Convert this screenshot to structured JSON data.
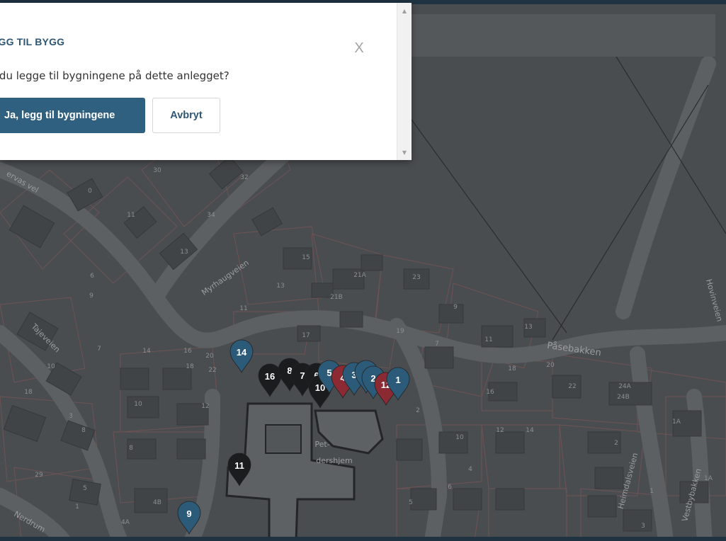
{
  "dialog": {
    "title": "EGG TIL BYGG",
    "close_label": "X",
    "message": "l du legge til bygningene på dette anlegget?",
    "confirm_label": "Ja, legg til bygningene",
    "cancel_label": "Avbryt"
  },
  "map": {
    "street_labels": [
      "Myrhaugveien",
      "Påsebakken",
      "Hovinveien",
      "Tajeveien",
      "Heimdalsveien",
      "Vestbybakken",
      "Nerdrum",
      "ervas vel"
    ],
    "place_labels": [
      "Pet-",
      "dershjem"
    ],
    "house_numbers": [
      "30",
      "32",
      "11",
      "34",
      "13",
      "15",
      "21A",
      "23",
      "21B",
      "13",
      "11",
      "9",
      "19",
      "17",
      "13",
      "11",
      "7",
      "14",
      "16",
      "18",
      "20",
      "22",
      "10",
      "12",
      "18",
      "20",
      "16",
      "22",
      "24A",
      "24B",
      "10",
      "12",
      "14",
      "4",
      "2",
      "1",
      "1A",
      "3",
      "5",
      "6",
      "2",
      "4B",
      "4A",
      "1",
      "3",
      "5",
      "6",
      "8",
      "29",
      "18",
      "1A",
      "10",
      "9",
      "7",
      "8",
      "0"
    ],
    "markers": [
      {
        "label": "14",
        "color": "#2c5b79"
      },
      {
        "label": "16",
        "color": "#1a1c1e"
      },
      {
        "label": "8",
        "color": "#1a1c1e"
      },
      {
        "label": "7",
        "color": "#1a1c1e"
      },
      {
        "label": "6",
        "color": "#1a1c1e"
      },
      {
        "label": "10",
        "color": "#1a1c1e"
      },
      {
        "label": "5",
        "color": "#2c5b79"
      },
      {
        "label": "4",
        "color": "#8c2a34"
      },
      {
        "label": "3",
        "color": "#2c5b79"
      },
      {
        "label": "",
        "color": "#2c5b79"
      },
      {
        "label": "2",
        "color": "#2c5b79"
      },
      {
        "label": "12",
        "color": "#8c2a34"
      },
      {
        "label": "1",
        "color": "#2c5b79"
      },
      {
        "label": "11",
        "color": "#1a1c1e"
      },
      {
        "label": "9",
        "color": "#2c5b79"
      },
      {
        "label": "",
        "color": "#8c2a34"
      }
    ]
  }
}
